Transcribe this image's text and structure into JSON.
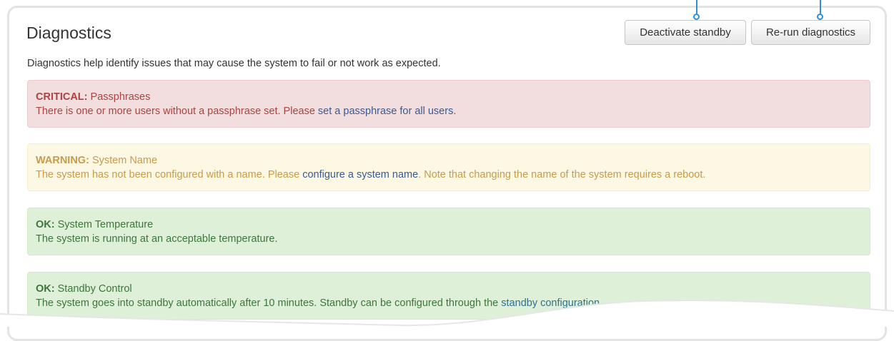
{
  "panel": {
    "title": "Diagnostics",
    "description": "Diagnostics help identify issues that may cause the system to fail or not work as expected."
  },
  "toolbar": {
    "deactivate_label": "Deactivate standby",
    "rerun_label": "Re-run diagnostics"
  },
  "alerts": [
    {
      "level": "CRITICAL:",
      "title": "Passphrases",
      "text_before": "There is one or more users without a passphrase set. Please ",
      "link": "set a passphrase for all users",
      "text_after": "."
    },
    {
      "level": "WARNING:",
      "title": "System Name",
      "text_before": "The system has not been configured with a name. Please ",
      "link": "configure a system name",
      "text_after": ". Note that changing the name of the system requires a reboot."
    },
    {
      "level": "OK:",
      "title": "System Temperature",
      "text_before": "The system is running at an acceptable temperature.",
      "link": "",
      "text_after": ""
    },
    {
      "level": "OK:",
      "title": "Standby Control",
      "text_before": "The system goes into standby automatically after 10 minutes. Standby can be configured through the ",
      "link": "standby configuration",
      "text_after": "."
    }
  ],
  "colors": {
    "critical": "#a94442",
    "warning": "#c89b4c",
    "ok": "#3c763d",
    "link": "#31708f",
    "callout": "#2f8fd0"
  }
}
